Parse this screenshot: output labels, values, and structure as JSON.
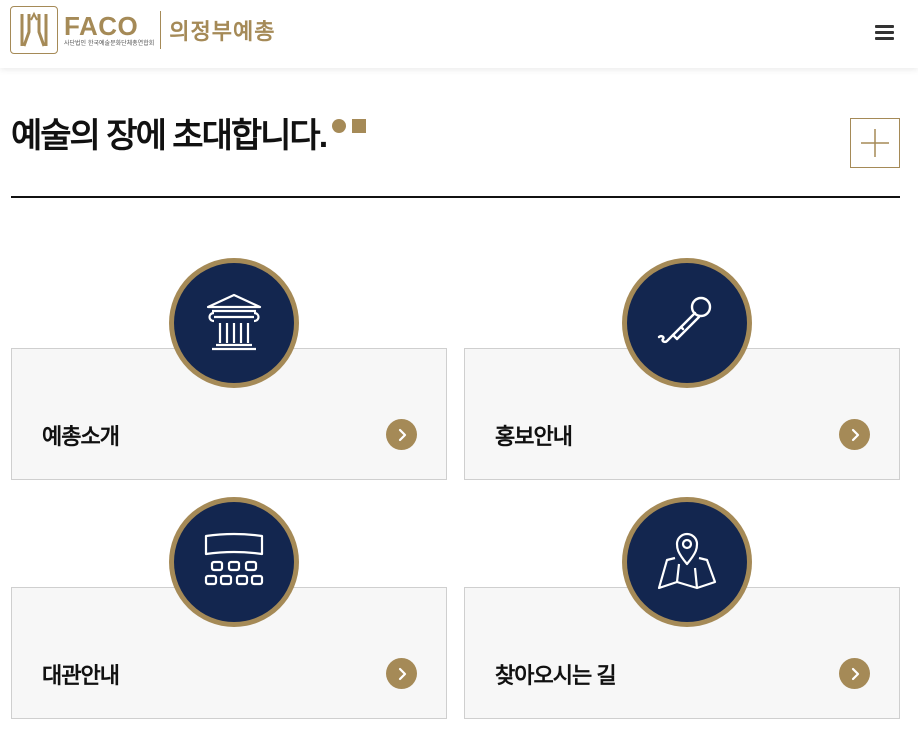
{
  "header": {
    "brand": "FACO",
    "brand_sub": "사단법인 한국예술문화단체총연합회",
    "org_name": "의정부예총",
    "menu_icon": "hamburger-menu-icon"
  },
  "hero": {
    "title": "예술의 장에 초대합니다.",
    "more_icon": "plus-icon"
  },
  "colors": {
    "accent": "#a58a57",
    "navy": "#13264f",
    "card_bg": "#f7f7f7",
    "text": "#111111"
  },
  "cards": [
    {
      "label": "예총소개",
      "icon": "temple-column-icon"
    },
    {
      "label": "홍보안내",
      "icon": "microphone-icon"
    },
    {
      "label": "대관안내",
      "icon": "theater-seats-icon"
    },
    {
      "label": "찾아오시는 길",
      "icon": "map-pin-icon"
    }
  ]
}
